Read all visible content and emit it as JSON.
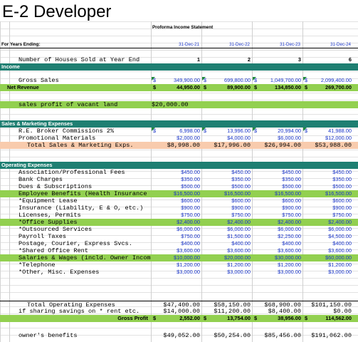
{
  "title": "E-2 Developer",
  "subtitle": "Proforma Income Statement",
  "years_label": "For Years Ending:",
  "years": [
    "31-Dec-21",
    "31-Dec-22",
    "31-Dec-23",
    "31-Dec-24"
  ],
  "houses": {
    "label": "Number of Houses Sold at Year End",
    "values": [
      "1",
      "2",
      "3",
      "6"
    ]
  },
  "income_header": "Income",
  "gross_sales": {
    "label": "Gross Sales",
    "values": [
      "349,900.00",
      "699,800.00",
      "1,049,700.00",
      "2,099,400.00"
    ]
  },
  "net_revenue": {
    "label": "Net Revenue",
    "values": [
      "44,950.00",
      "89,900.00",
      "134,850.00",
      "269,700.00"
    ]
  },
  "vacant_land": {
    "label": "sales profit of vacant land",
    "value": "$20,000.00"
  },
  "sm_header": "Sales & Marketing Expenses",
  "re_broker": {
    "label": "R.E. Broker Commissions 2%",
    "values": [
      "6,998.00",
      "13,996.00",
      "20,994.00",
      "41,988.00"
    ]
  },
  "promo": {
    "label": "Promotional Materials",
    "values": [
      "$2,000.00",
      "$4,000.00",
      "$6,000.00",
      "$12,000.00"
    ]
  },
  "total_sm": {
    "label": "Total Sales & Marketing Exps.",
    "values": [
      "$8,998.00",
      "$17,996.00",
      "$26,994.00",
      "$53,988.00"
    ]
  },
  "op_header": "Operating Expenses",
  "op_rows": [
    {
      "label": "Association/Professional Fees",
      "values": [
        "$450.00",
        "$450.00",
        "$450.00",
        "$450.00"
      ],
      "green": false
    },
    {
      "label": "Bank Charges",
      "values": [
        "$350.00",
        "$350.00",
        "$350.00",
        "$350.00"
      ],
      "green": false
    },
    {
      "label": "Dues & Subscriptions",
      "values": [
        "$500.00",
        "$500.00",
        "$500.00",
        "$500.00"
      ],
      "green": false
    },
    {
      "label": "Employee Benefits (Health Insurance 0",
      "values": [
        "$16,500.00",
        "$16,500.00",
        "$16,500.00",
        "$16,500.00"
      ],
      "green": true
    },
    {
      "label": "*Equipment Lease",
      "values": [
        "$600.00",
        "$600.00",
        "$600.00",
        "$600.00"
      ],
      "green": false
    },
    {
      "label": "Insurance (Liability, E & O, etc.)",
      "values": [
        "$900.00",
        "$900.00",
        "$900.00",
        "$900.00"
      ],
      "green": false
    },
    {
      "label": "Licenses, Permits",
      "values": [
        "$750.00",
        "$750.00",
        "$750.00",
        "$750.00"
      ],
      "green": false
    },
    {
      "label": "*Office Supplies",
      "values": [
        "$2,400.00",
        "$2,400.00",
        "$2,400.00",
        "$2,400.00"
      ],
      "green": true
    },
    {
      "label": "*Outsourced Services",
      "values": [
        "$6,000.00",
        "$6,000.00",
        "$6,000.00",
        "$6,000.00"
      ],
      "green": false
    },
    {
      "label": "Payroll Taxes",
      "values": [
        "$750.00",
        "$1,500.00",
        "$2,250.00",
        "$4,500.00"
      ],
      "green": false
    },
    {
      "label": "Postage, Courier, Express Svcs.",
      "values": [
        "$400.00",
        "$400.00",
        "$400.00",
        "$400.00"
      ],
      "green": false
    },
    {
      "label": "*Shared Office Rent",
      "values": [
        "$3,600.00",
        "$3,600.00",
        "$3,600.00",
        "$3,600.00"
      ],
      "green": false
    },
    {
      "label": "Salaries & Wages (incld. Owner Income",
      "values": [
        "$10,000.00",
        "$20,000.00",
        "$30,000.00",
        "$60,000.00"
      ],
      "green": true
    },
    {
      "label": "*Telephone",
      "values": [
        "$1,200.00",
        "$1,200.00",
        "$1,200.00",
        "$1,200.00"
      ],
      "green": false
    },
    {
      "label": "*Other, Misc. Expenses",
      "values": [
        "$3,000.00",
        "$3,000.00",
        "$3,000.00",
        "$3,000.00"
      ],
      "green": false
    }
  ],
  "total_op": {
    "label": "Total Operating Expenses",
    "values": [
      "$47,400.00",
      "$58,150.00",
      "$68,900.00",
      "$101,150.00"
    ]
  },
  "sharing": {
    "label": "if sharing savings on * rent etc.",
    "values": [
      "$14,000.00",
      "$11,200.00",
      "$8,400.00",
      "$0.00"
    ]
  },
  "gross_profit": {
    "label": "Gross Profit",
    "values": [
      "2,552.00",
      "13,754.00",
      "38,956.00",
      "114,562.00"
    ]
  },
  "owner": {
    "label": "owner's benefits",
    "values": [
      "$49,052.00",
      "$50,254.00",
      "$85,456.00",
      "$191,062.00"
    ]
  },
  "dollar": "$"
}
